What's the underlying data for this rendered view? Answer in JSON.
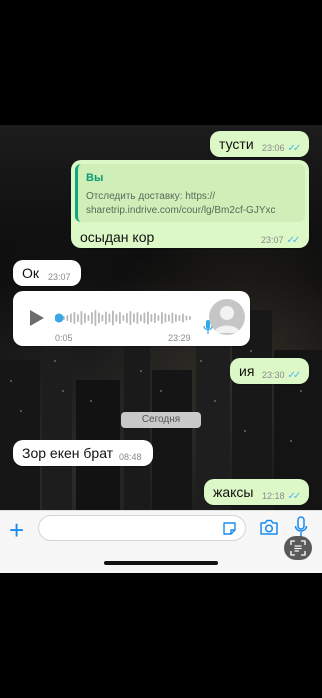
{
  "messages": {
    "m1": {
      "text": "тусти",
      "time": "23:06"
    },
    "m2": {
      "reply_author": "Вы",
      "reply_line1": "Отследить доставку: https://",
      "reply_line2": "sharetrip.indrive.com/cour/lg/Bm2cf-GJYxc",
      "text": "осыдан кор",
      "time": "23:07"
    },
    "m3": {
      "text": "Ок",
      "time": "23:07"
    },
    "voice": {
      "duration": "0:05",
      "time": "23:29",
      "progress": 0.0
    },
    "m4": {
      "text": "ия",
      "time": "23:30"
    },
    "date_separator": "Сегодня",
    "m5": {
      "text": "Зор екен брат",
      "time": "08:48"
    },
    "m6": {
      "text": "жаксы",
      "time": "12:18"
    }
  },
  "icons": {
    "read": "double-check-icon",
    "play": "play-icon",
    "mic": "microphone-icon",
    "sticker": "sticker-icon",
    "camera": "camera-icon",
    "plus": "plus-icon",
    "ocr": "text-scan-icon"
  },
  "colors": {
    "outgoing": "#dcf8c6",
    "incoming": "#ffffff",
    "accent": "#1a8cf0",
    "ticks": "#4fb6ec"
  }
}
